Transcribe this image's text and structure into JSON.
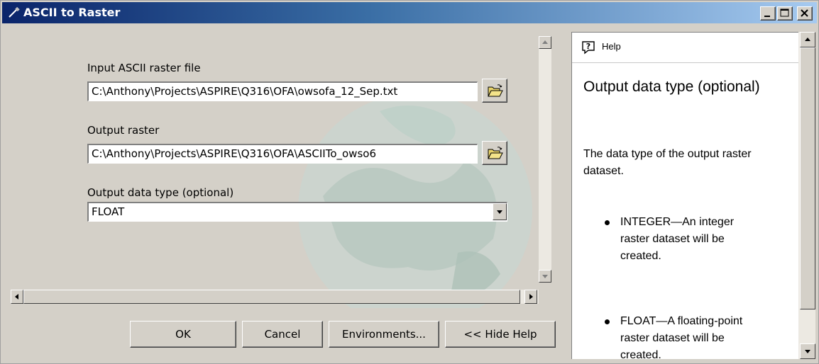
{
  "window": {
    "title": "ASCII to Raster",
    "minimize_label": "_",
    "restore_label": "□",
    "close_label": "×"
  },
  "form": {
    "input_label": "Input ASCII raster file",
    "input_value": "C:\\Anthony\\Projects\\ASPIRE\\Q316\\OFA\\owsofa_12_Sep.txt",
    "output_label": "Output raster",
    "output_value": "C:\\Anthony\\Projects\\ASPIRE\\Q316\\OFA\\ASCIITo_owso6",
    "type_label": "Output data type (optional)",
    "type_value": "FLOAT"
  },
  "buttons": {
    "ok": "OK",
    "cancel": "Cancel",
    "environments": "Environments...",
    "hide_help": "<< Hide Help"
  },
  "help": {
    "header": "Help",
    "title": "Output data type (optional)",
    "description": "The data type of the output raster dataset.",
    "bullets": [
      "INTEGER—An integer raster dataset will be created.",
      "FLOAT—A floating-point raster dataset will be created."
    ]
  },
  "colors": {
    "titlebar_start": "#0a246a",
    "titlebar_end": "#a6caf0",
    "face": "#d4d0c8"
  },
  "icons": [
    "tool-icon",
    "folder-open-icon",
    "help-icon",
    "chevron-down-icon",
    "scroll-arrow-icon"
  ]
}
